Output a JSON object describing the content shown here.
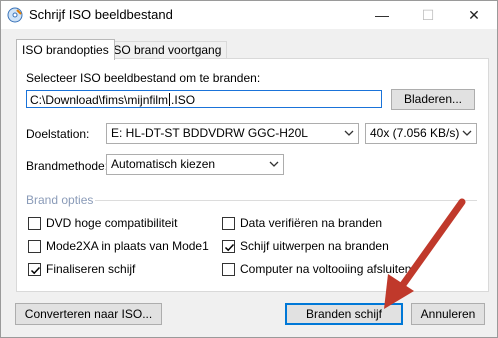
{
  "window": {
    "title": "Schrijf ISO beeldbestand",
    "minimize": "—",
    "maximize": "☐",
    "close": "✕"
  },
  "tabs": [
    {
      "label": "ISO brandopties",
      "active": true
    },
    {
      "label": "ISO brand voortgang",
      "active": false
    }
  ],
  "file": {
    "label": "Selecteer ISO beeldbestand om te branden:",
    "value_before_caret": "C:\\Download\\fims\\mijnfilm",
    "value_after_caret": ".ISO",
    "browse_label": "Bladeren..."
  },
  "drive": {
    "label": "Doelstation:",
    "selected": "E: HL-DT-ST BDDVDRW GGC-H20L",
    "speed_selected": "40x (7.056 KB/s)"
  },
  "burn_method": {
    "label": "Brandmethode:",
    "selected": "Automatisch kiezen"
  },
  "options": {
    "group_label": "Brand opties",
    "left": [
      {
        "label": "DVD hoge compatibiliteit",
        "checked": false
      },
      {
        "label": "Mode2XA in plaats van Mode1",
        "checked": false
      },
      {
        "label": "Finaliseren schijf",
        "checked": true
      }
    ],
    "right": [
      {
        "label": "Data verifiëren na branden",
        "checked": false
      },
      {
        "label": "Schijf uitwerpen na branden",
        "checked": true
      },
      {
        "label": "Computer na voltooiing afsluiten",
        "checked": false
      }
    ]
  },
  "footer": {
    "convert_label": "Converteren naar ISO...",
    "burn_label": "Branden schijf",
    "cancel_label": "Annuleren"
  },
  "colors": {
    "accent": "#0078d7",
    "annotation_arrow": "#c0392b",
    "group_label": "#8a9bb8"
  },
  "icons": {
    "app": "disc-burn-icon",
    "dropdown": "chevron-down-icon",
    "check": "checkmark-icon"
  }
}
